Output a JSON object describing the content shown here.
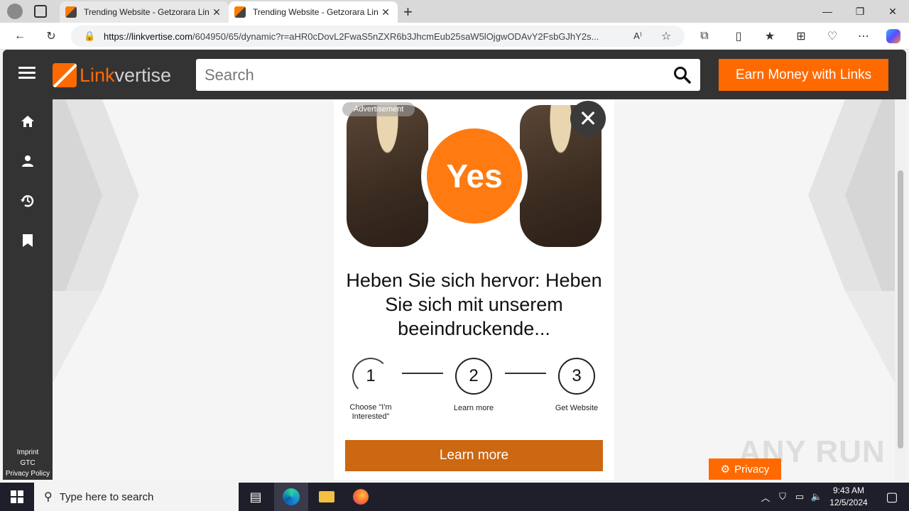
{
  "browser": {
    "tabs": [
      {
        "title": "Trending Website - Getzorara Lin"
      },
      {
        "title": "Trending Website - Getzorara Lin"
      }
    ],
    "url_host": "https://linkvertise.com",
    "url_path": "/604950/65/dynamic?r=aHR0cDovL2FwaS5nZXR6b3JhcmEub25saW5lOjgwODAvY2FsbGJhY2s..."
  },
  "header": {
    "logo_part1": "Link",
    "logo_part2": "vertise",
    "search_placeholder": "Search",
    "earn_button": "Earn Money with Links"
  },
  "sidebar": {
    "icons": [
      "home-icon",
      "user-icon",
      "history-icon",
      "bookmark-icon"
    ],
    "links": [
      "Imprint",
      "GTC",
      "Privacy Policy"
    ]
  },
  "ad": {
    "label": "Advertisement",
    "yes_label": "Yes",
    "headline": "Heben Sie sich hervor: Heben Sie sich mit unserem beeindruckende...",
    "steps": [
      {
        "number": "1",
        "label": "Choose \"I'm Interested\""
      },
      {
        "number": "2",
        "label": "Learn more"
      },
      {
        "number": "3",
        "label": "Get Website"
      }
    ],
    "cta": "Learn more"
  },
  "privacy_button": "Privacy",
  "watermark": "ANY RUN",
  "taskbar": {
    "search_placeholder": "Type here to search",
    "time": "9:43 AM",
    "date": "12/5/2024"
  }
}
